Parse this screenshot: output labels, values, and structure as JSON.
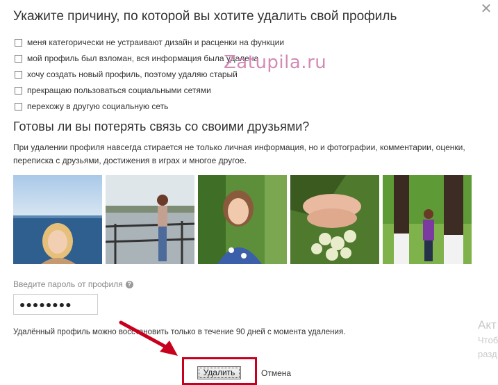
{
  "dialog": {
    "title": "Укажите причину, по которой вы хотите удалить свой профиль",
    "close_symbol": "✕"
  },
  "reasons": [
    {
      "label": "меня категорически не устраивают дизайн и расценки на функции",
      "checked": false
    },
    {
      "label": "мой профиль был взломан, вся информация была удалена",
      "checked": false
    },
    {
      "label": "хочу создать новый профиль, поэтому удаляю старый",
      "checked": false
    },
    {
      "label": "прекращаю пользоваться социальными сетями",
      "checked": false
    },
    {
      "label": "перехожу в другую социальную сеть",
      "checked": false
    }
  ],
  "watermark": "Zatupila.ru",
  "section": {
    "title": "Готовы ли вы потерять связь со своими друзьями?",
    "description": "При удалении профиля навсегда стирается не только личная информация, но и фотографии, комментарии, оценки, переписка с друзьями, достижения в играх и многое другое."
  },
  "photos": [
    {
      "name": "photo-girl-by-sea",
      "alt": "girl by sea"
    },
    {
      "name": "photo-girl-on-pier",
      "alt": "girl on pier"
    },
    {
      "name": "photo-girl-portrait",
      "alt": "girl portrait"
    },
    {
      "name": "photo-hands-bouquet",
      "alt": "hands with bouquet"
    },
    {
      "name": "photo-girl-by-tree",
      "alt": "girl by tree"
    }
  ],
  "password": {
    "label": "Введите пароль от профиля",
    "help_symbol": "?",
    "value": "●●●●●●●●"
  },
  "note": "Удалённый профиль можно восстановить только в течение 90 дней с момента удаления.",
  "ghost_text": [
    "Акт",
    "Чтоб",
    "разд"
  ],
  "buttons": {
    "delete": "Удалить",
    "cancel": "Отмена"
  },
  "colors": {
    "highlight": "#c8001e",
    "watermark": "#d38ab6"
  }
}
